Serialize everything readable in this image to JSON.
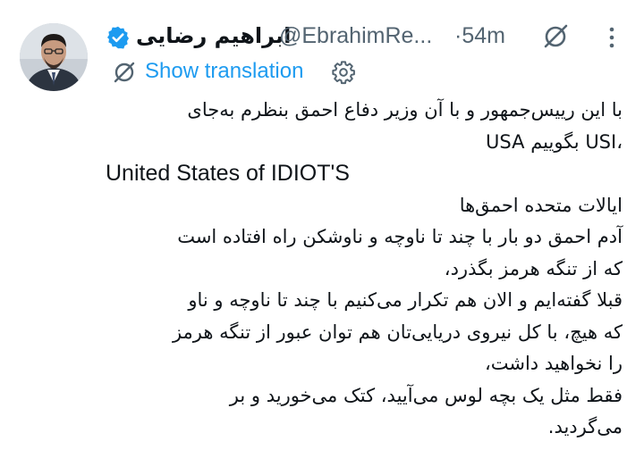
{
  "author": {
    "display_name": "ابراهیم رضایی",
    "handle": "@EbrahimRe...",
    "verified_icon": "verified-badge-icon",
    "avatar_icon": "profile-photo"
  },
  "meta": {
    "time": "·54m",
    "grok_icon": "grok-slash-circle-icon",
    "more_icon": "more-vertical-icon"
  },
  "translate": {
    "icon": "grok-translate-icon",
    "label": "Show translation",
    "settings_icon": "gear-icon"
  },
  "tweet": {
    "lines": [
      "با این رییس‌جمهور و با آن وزیر دفاع احمق بنظرم به‌جای",
      "USA بگوییم USI،",
      "United States of IDIOT'S",
      "ایالات متحده احمق‌ها",
      "آدم احمق دو بار با چند تا ناوچه و ناوشکن راه افتاده است",
      "که از تنگه هرمز بگذرد،",
      "قبلا گفته‌ایم و الان هم تکرار می‌کنیم با چند تا ناوچه و ناو",
      "که هیچ، با کل نیروی دریایی‌تان هم توان عبور از تنگه هرمز",
      "را نخواهید داشت،",
      "فقط مثل یک بچه لوس می‌آیید، کتک می‌خورید و بر",
      "می‌گردید."
    ]
  },
  "colors": {
    "text": "#0f1419",
    "secondary": "#536471",
    "link": "#1d9bf0",
    "background": "#ffffff"
  }
}
